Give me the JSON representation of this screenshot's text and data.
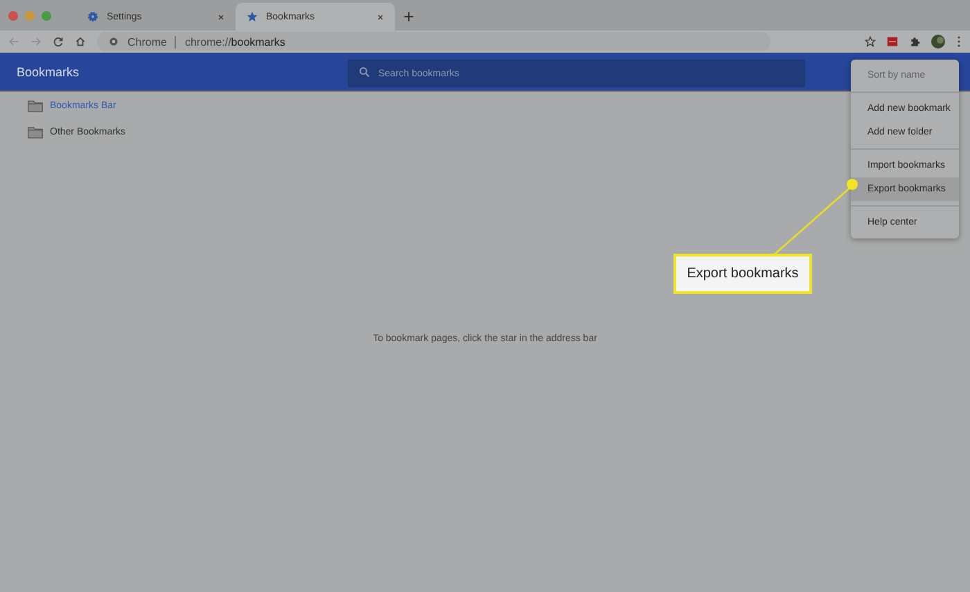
{
  "tabs": [
    {
      "label": "Settings",
      "kind": "settings",
      "selected": false
    },
    {
      "label": "Bookmarks",
      "kind": "bookmarks",
      "selected": true
    }
  ],
  "address_bar": {
    "site": "Chrome",
    "url_prefix": "chrome://",
    "url_path": "bookmarks"
  },
  "header": {
    "title": "Bookmarks",
    "search_placeholder": "Search bookmarks"
  },
  "sidebar": {
    "items": [
      {
        "label": "Bookmarks Bar",
        "selected": true
      },
      {
        "label": "Other Bookmarks",
        "selected": false
      }
    ]
  },
  "empty_message": "To bookmark pages, click the star in the address bar",
  "menu": {
    "groups": [
      [
        {
          "label": "Sort by name",
          "disabled": true,
          "selected": false
        }
      ],
      [
        {
          "label": "Add new bookmark",
          "disabled": false,
          "selected": false
        },
        {
          "label": "Add new folder",
          "disabled": false,
          "selected": false
        }
      ],
      [
        {
          "label": "Import bookmarks",
          "disabled": false,
          "selected": false
        },
        {
          "label": "Export bookmarks",
          "disabled": false,
          "selected": true
        }
      ],
      [
        {
          "label": "Help center",
          "disabled": false,
          "selected": false
        }
      ]
    ]
  },
  "callout": {
    "text": "Export bookmarks"
  }
}
